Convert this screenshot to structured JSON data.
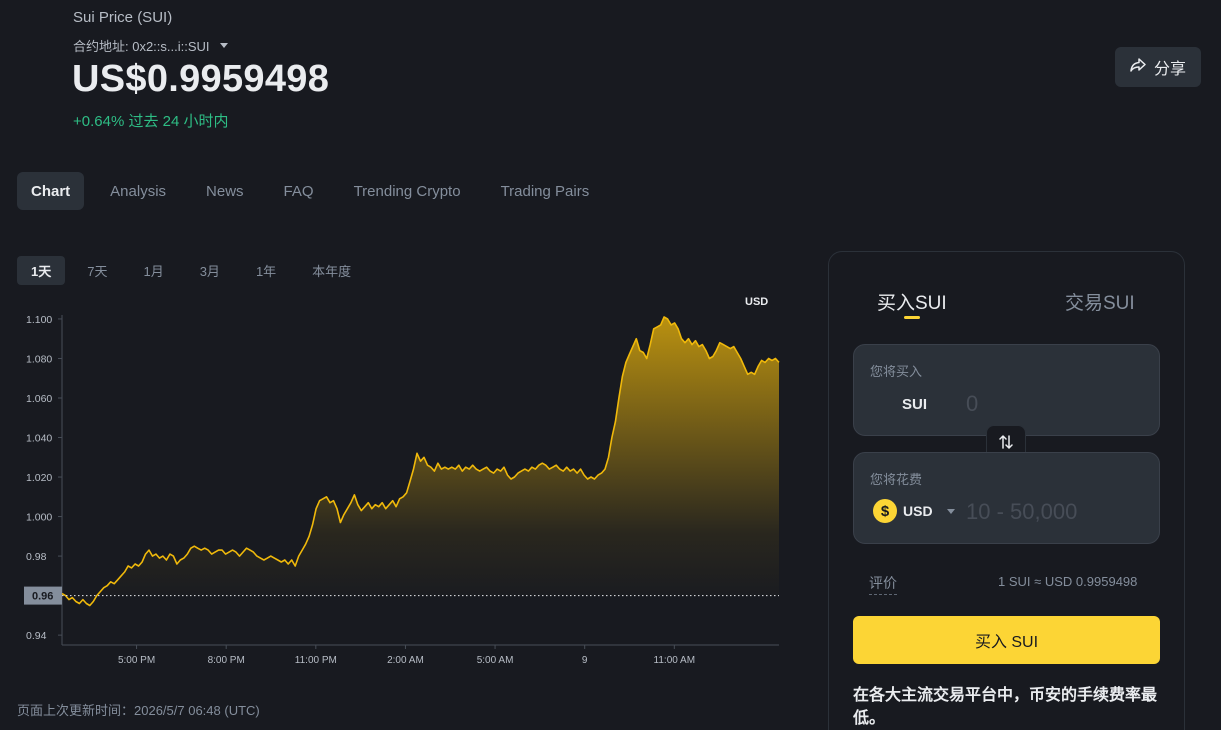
{
  "header": {
    "coin_name": "Sui Price (SUI)",
    "contract_label": "合约地址: 0x2::s...i::SUI",
    "price": "US$0.9959498",
    "change": "+0.64% 过去 24 小时内",
    "share_label": "分享"
  },
  "tabs": [
    {
      "label": "Chart",
      "active": true
    },
    {
      "label": "Analysis",
      "active": false
    },
    {
      "label": "News",
      "active": false
    },
    {
      "label": "FAQ",
      "active": false
    },
    {
      "label": "Trending Crypto",
      "active": false
    },
    {
      "label": "Trading Pairs",
      "active": false
    }
  ],
  "ranges": [
    {
      "label": "1天",
      "active": true
    },
    {
      "label": "7天",
      "active": false
    },
    {
      "label": "1月",
      "active": false
    },
    {
      "label": "3月",
      "active": false
    },
    {
      "label": "1年",
      "active": false
    },
    {
      "label": "本年度",
      "active": false
    }
  ],
  "chart_currency": "USD",
  "chart_data": {
    "type": "area",
    "series_color": "#f0b90b",
    "reference_value": 0.96,
    "reference_label": "0.96",
    "ylim": [
      0.935,
      1.102
    ],
    "yticks": [
      0.94,
      0.98,
      1.0,
      1.02,
      1.04,
      1.06,
      1.08,
      1.1
    ],
    "ytick_labels": [
      "0.94",
      "0.98",
      "1.000",
      "1.020",
      "1.040",
      "1.060",
      "1.080",
      "1.100"
    ],
    "xticks": [
      {
        "t": 0.104,
        "label": "5:00 PM"
      },
      {
        "t": 0.229,
        "label": "8:00 PM"
      },
      {
        "t": 0.354,
        "label": "11:00 PM"
      },
      {
        "t": 0.479,
        "label": "2:00 AM"
      },
      {
        "t": 0.604,
        "label": "5:00 AM"
      },
      {
        "t": 0.729,
        "label": "9"
      },
      {
        "t": 0.854,
        "label": "11:00 AM"
      }
    ],
    "values": [
      0.961,
      0.96,
      0.958,
      0.959,
      0.957,
      0.956,
      0.958,
      0.956,
      0.955,
      0.957,
      0.96,
      0.962,
      0.964,
      0.965,
      0.967,
      0.966,
      0.968,
      0.97,
      0.972,
      0.975,
      0.974,
      0.976,
      0.975,
      0.977,
      0.981,
      0.983,
      0.98,
      0.981,
      0.979,
      0.98,
      0.978,
      0.981,
      0.98,
      0.976,
      0.978,
      0.979,
      0.981,
      0.984,
      0.985,
      0.984,
      0.983,
      0.984,
      0.983,
      0.981,
      0.982,
      0.983,
      0.983,
      0.981,
      0.982,
      0.983,
      0.982,
      0.98,
      0.982,
      0.984,
      0.983,
      0.982,
      0.98,
      0.979,
      0.978,
      0.979,
      0.98,
      0.979,
      0.978,
      0.977,
      0.978,
      0.976,
      0.978,
      0.975,
      0.98,
      0.983,
      0.986,
      0.99,
      0.996,
      1.004,
      1.008,
      1.009,
      1.01,
      1.007,
      1.008,
      1.004,
      0.997,
      1.001,
      1.004,
      1.007,
      1.011,
      1.006,
      1.003,
      1.005,
      1.007,
      1.004,
      1.006,
      1.005,
      1.007,
      1.004,
      1.006,
      1.008,
      1.005,
      1.009,
      1.01,
      1.012,
      1.018,
      1.024,
      1.032,
      1.028,
      1.03,
      1.026,
      1.025,
      1.023,
      1.027,
      1.024,
      1.025,
      1.024,
      1.025,
      1.024,
      1.026,
      1.023,
      1.025,
      1.024,
      1.026,
      1.024,
      1.023,
      1.024,
      1.025,
      1.023,
      1.022,
      1.024,
      1.023,
      1.025,
      1.021,
      1.019,
      1.02,
      1.022,
      1.023,
      1.024,
      1.023,
      1.025,
      1.024,
      1.026,
      1.027,
      1.026,
      1.024,
      1.025,
      1.026,
      1.024,
      1.023,
      1.025,
      1.023,
      1.024,
      1.022,
      1.024,
      1.021,
      1.019,
      1.02,
      1.019,
      1.021,
      1.022,
      1.024,
      1.03,
      1.04,
      1.048,
      1.06,
      1.071,
      1.078,
      1.082,
      1.086,
      1.09,
      1.084,
      1.083,
      1.08,
      1.087,
      1.095,
      1.096,
      1.097,
      1.101,
      1.1,
      1.097,
      1.098,
      1.095,
      1.09,
      1.088,
      1.09,
      1.087,
      1.089,
      1.086,
      1.087,
      1.084,
      1.08,
      1.081,
      1.084,
      1.088,
      1.087,
      1.086,
      1.085,
      1.086,
      1.083,
      1.08,
      1.076,
      1.072,
      1.073,
      1.072,
      1.076,
      1.079,
      1.078,
      1.08,
      1.079,
      1.08,
      1.078
    ]
  },
  "updated": "页面上次更新时间：2026/5/7 06:48 (UTC)",
  "panel": {
    "tab_buy": "买入SUI",
    "tab_trade": "交易SUI",
    "receive_label": "您将买入",
    "receive_currency": "SUI",
    "receive_placeholder": "0",
    "spend_label": "您将花费",
    "spend_currency": "USD",
    "spend_placeholder": "10 - 50,000",
    "usd_symbol": "$",
    "rate_label": "评价",
    "rate_value": "1 SUI ≈ USD 0.9959498",
    "buy_button": "买入 SUI",
    "promo": "在各大主流交易平台中，币安的手续费率最低。"
  }
}
